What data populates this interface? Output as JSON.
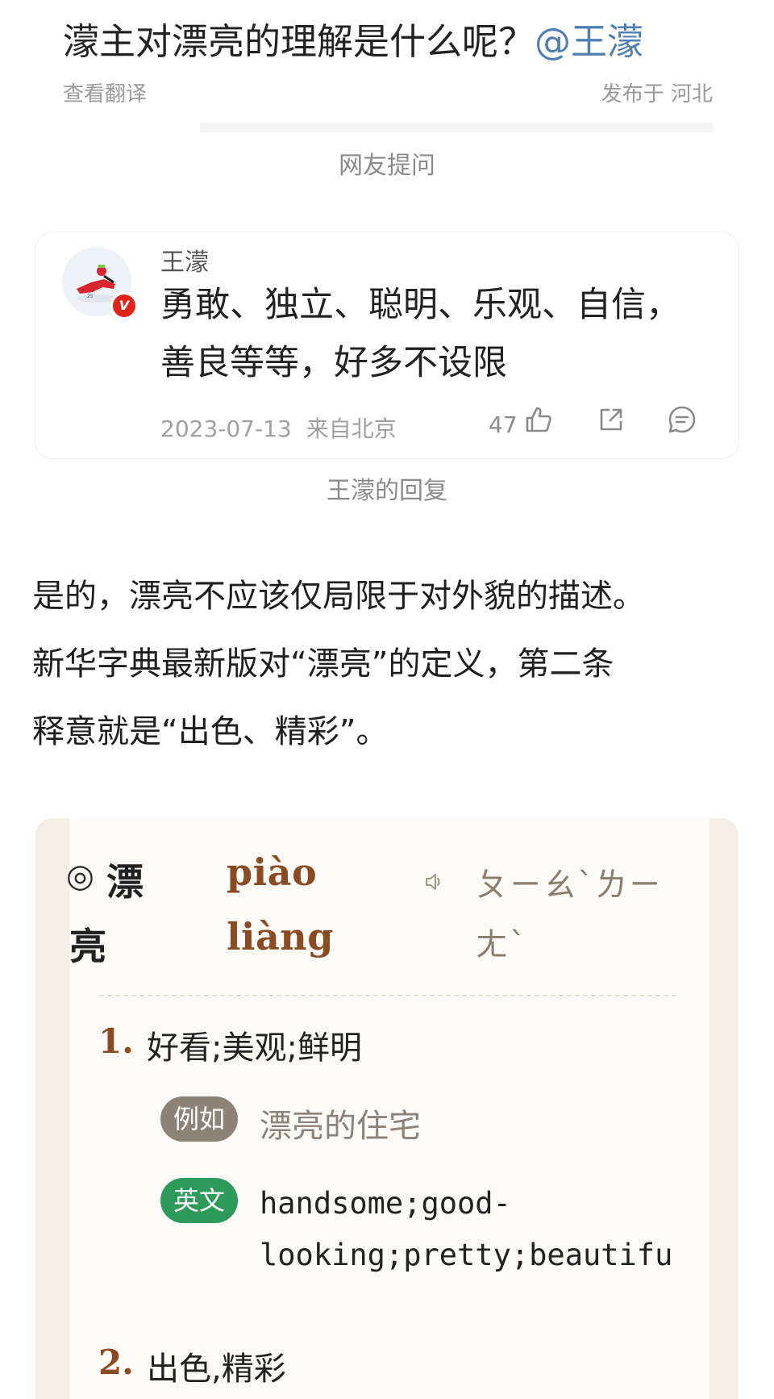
{
  "question": {
    "title": "濛主对漂亮的理解是什么呢？",
    "mention": "@王濛",
    "translate_link": "查看翻译",
    "location": "发布于 河北",
    "caption": "网友提问"
  },
  "reply": {
    "author": "王濛",
    "verified_badge": "V",
    "text": "勇敢、独立、聪明、乐观、自信，善良等等，好多不设限",
    "date": "2023-07-13",
    "source": "来自北京",
    "like_count": "47",
    "caption": "王濛的回复",
    "icons": [
      "thumbs-up-icon",
      "share-icon",
      "comment-icon"
    ]
  },
  "body": {
    "line1": "是的，漂亮不应该仅局限于对外貌的描述。",
    "line2": "新华字典最新版对“漂亮”的定义，第二条",
    "line3": "释意就是“出色、精彩”。"
  },
  "dictionary": {
    "ring_symbol": "◎",
    "word_char1": "漂",
    "word_char2": "亮",
    "pinyin1": "piào",
    "pinyin2": "liàng",
    "zhuyin_line1": "ㄆㄧㄠˋㄌㄧ",
    "zhuyin_line2": "ㄤˋ",
    "speaker_icon": "speaker-icon",
    "definitions": [
      {
        "num": "1.",
        "text": "好看;美观;鲜明",
        "example_label": "例如",
        "example": "漂亮的住宅",
        "english_label": "英文",
        "english_line1": "handsome;good-",
        "english_line2": "looking;pretty;beautifu"
      },
      {
        "num": "2.",
        "text": "出色,精彩"
      }
    ]
  },
  "colors": {
    "mention": "#4f7fb2",
    "pinyin": "#8a4a22",
    "tag_example": "#8c8277",
    "tag_english": "#2e9a5a",
    "badge": "#e2231a"
  }
}
